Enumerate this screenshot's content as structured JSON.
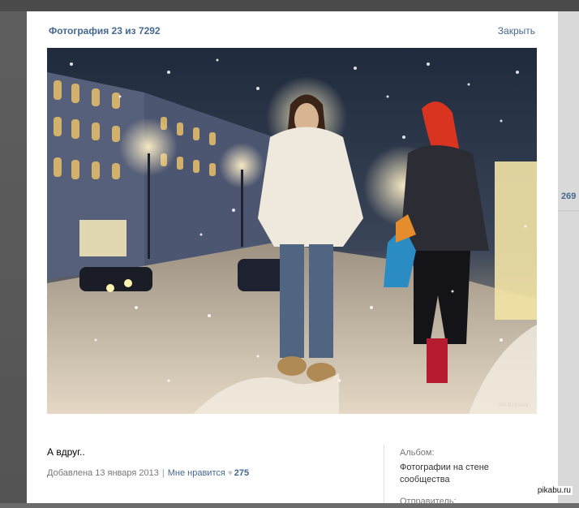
{
  "viewer": {
    "title": "Фотография 23 из 7292",
    "close_label": "Закрыть",
    "photo": {
      "description": "",
      "watermark": "SN-BIRSAN"
    },
    "caption": "А вдруг..",
    "meta": {
      "date_text": "Добавлена 13 января 2013",
      "separator": "|",
      "like_label": "Мне нравится",
      "like_icon": "heart-icon",
      "like_count": "275"
    },
    "sidebar": {
      "album_label": "Альбом:",
      "album_name": "Фотографии на стене сообщества",
      "sender_label": "Отправитель:"
    }
  },
  "background": {
    "right_count": "269"
  },
  "site_watermark": "pikabu.ru",
  "colors": {
    "link": "#45688e",
    "text_muted": "#777777",
    "overlay": "#6b6b6b"
  }
}
